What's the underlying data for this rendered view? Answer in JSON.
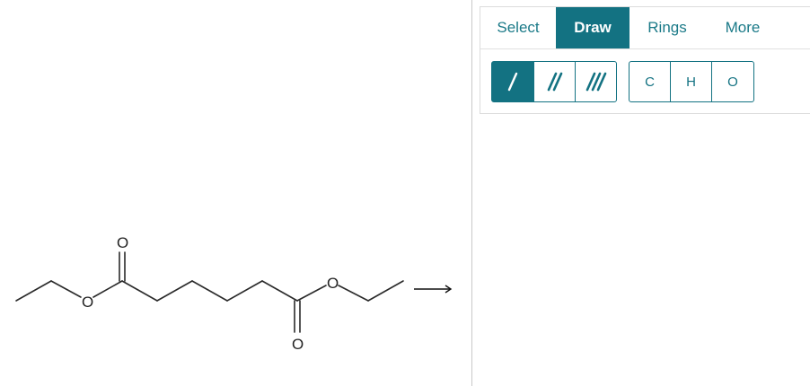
{
  "tabs": [
    {
      "label": "Select",
      "active": false
    },
    {
      "label": "Draw",
      "active": true
    },
    {
      "label": "Rings",
      "active": false
    },
    {
      "label": "More",
      "active": false
    }
  ],
  "bond_tools": [
    {
      "icon": "single-bond-icon",
      "active": true
    },
    {
      "icon": "double-bond-icon",
      "active": false
    },
    {
      "icon": "triple-bond-icon",
      "active": false
    }
  ],
  "atom_tools": [
    "C",
    "H",
    "O"
  ],
  "molecule": {
    "atoms": {
      "o_top": "O",
      "o_ester_left": "O",
      "o_bottom": "O",
      "o_ester_right": "O"
    }
  },
  "reaction_arrow": "→",
  "colors": {
    "accent": "#137282",
    "tab_text": "#1b7a88"
  }
}
